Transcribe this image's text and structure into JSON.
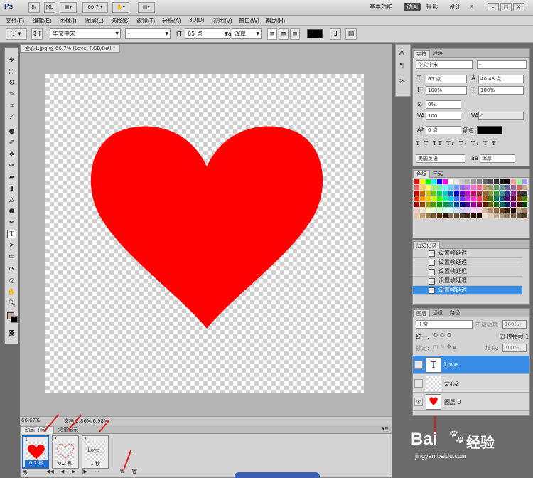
{
  "app": {
    "logo": "Ps",
    "zoom": "66.7",
    "workspaces": [
      "基本功能",
      "动画",
      "摄影",
      "设计"
    ],
    "active_workspace": "动画",
    "more": "»"
  },
  "menu": [
    "文件(F)",
    "编辑(E)",
    "图像(I)",
    "图层(L)",
    "选择(S)",
    "滤镜(T)",
    "分析(A)",
    "3D(D)",
    "视图(V)",
    "窗口(W)",
    "帮助(H)"
  ],
  "options": {
    "tool_icon": "T",
    "font_family": "华文中宋",
    "font_style": "-",
    "size_label": "tT",
    "font_size": "65 点",
    "aa_label": "aa",
    "antialias": "浑厚",
    "color_hex": "#000000"
  },
  "document": {
    "tab_title": "爱心1.jpg @ 66.7% (Love, RGB/8#) *",
    "zoom": "66.67%",
    "doc_size": "文档:2.86M/6.98M"
  },
  "animation": {
    "tabs": [
      "动画（帧）",
      "测量记录"
    ],
    "frames": [
      {
        "num": "1",
        "delay": "0.2 秒"
      },
      {
        "num": "2",
        "delay": "0.2 秒"
      },
      {
        "num": "3",
        "delay": "1 秒",
        "text": "Love"
      }
    ],
    "loop": "永远"
  },
  "character_panel": {
    "tabs": [
      "字符",
      "段落"
    ],
    "font_family": "华文中宋",
    "font_style": "-",
    "size": "65 点",
    "leading": "40.48 点",
    "vscale": "100%",
    "hscale": "100%",
    "tracking_adj": "0%",
    "tracking": "100",
    "kerning": "0",
    "baseline": "0 点",
    "color_label": "颜色:",
    "style_buttons": [
      "T",
      "T",
      "TT",
      "Tr",
      "T¹",
      "T₁",
      "T",
      "Ŧ"
    ],
    "language": "美国英语",
    "antialias": "浑厚"
  },
  "swatches_panel": {
    "tabs": [
      "色板",
      "样式"
    ]
  },
  "history_panel": {
    "title": "历史记录",
    "items": [
      "设置帧延迟",
      "设置帧延迟",
      "设置帧延迟",
      "设置帧延迟",
      "设置帧延迟"
    ]
  },
  "layers_panel": {
    "tabs": [
      "图层",
      "通道",
      "路径"
    ],
    "blend_mode": "正常",
    "opacity_label": "不透明度:",
    "opacity": "100%",
    "unify_label": "统一:",
    "propagate_label": "传播帧 1",
    "lock_label": "锁定:",
    "fill_label": "填充:",
    "fill": "100%",
    "layers": [
      {
        "name": "Love",
        "thumb": "T",
        "selected": true
      },
      {
        "name": "爱心2",
        "thumb": "",
        "selected": false
      },
      {
        "name": "图层 0",
        "thumb": "♥",
        "selected": false
      }
    ]
  },
  "watermark": {
    "brand": "Bai",
    "brand2": "经验",
    "url": "jingyan.baidu.com"
  },
  "colors": {
    "heart": "#ff0000",
    "selection": "#3a8ee6",
    "frame_select": "#1f6ed6"
  }
}
